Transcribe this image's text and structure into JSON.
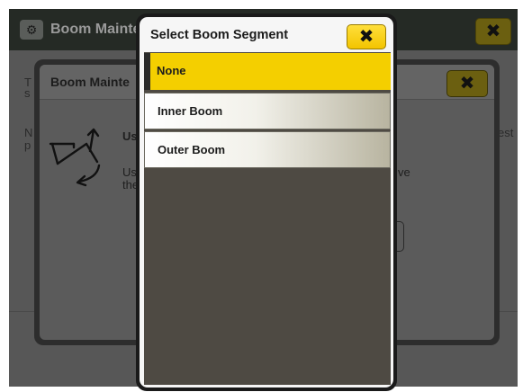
{
  "background_screen": {
    "title": "Boom Mainte",
    "app_icon": "tractor-gear-icon",
    "close_icon": "close-icon",
    "text_fragments": [
      "T",
      "s",
      "N",
      "p",
      "est"
    ]
  },
  "middle_dialog": {
    "title": "Boom Mainte",
    "close_icon": "close-icon",
    "icon": "boom-fold-icon",
    "heading_fragment": "Us",
    "body_fragments": [
      "Us",
      "the",
      "ve"
    ]
  },
  "modal": {
    "title": "Select Boom Segment",
    "close_icon": "close-icon",
    "options": [
      {
        "label": "None",
        "selected": true
      },
      {
        "label": "Inner Boom",
        "selected": false
      },
      {
        "label": "Outer Boom",
        "selected": false
      }
    ]
  },
  "colors": {
    "accent_yellow": "#f4cf00",
    "list_background": "#4e4a43",
    "modal_frame": "#1a1a1a"
  }
}
